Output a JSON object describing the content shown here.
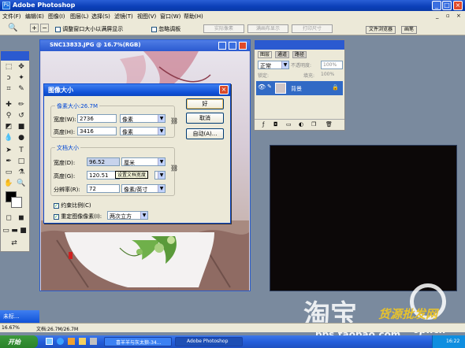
{
  "app": {
    "title": "Adobe Photoshop"
  },
  "window_controls": {
    "minimize": "_",
    "maximize": "□",
    "close": "×"
  },
  "menu": [
    "文件(F)",
    "编辑(E)",
    "图像(I)",
    "图层(L)",
    "选择(S)",
    "滤镜(T)",
    "视图(V)",
    "窗口(W)",
    "帮助(H)"
  ],
  "options_bar": {
    "fit_window_label": "调整窗口大小以满屏显示",
    "ignore_palettes_label": "忽略调板",
    "actual_pixels": "实际像素",
    "fit_screen": "满画布显示",
    "print_size": "打印尺寸"
  },
  "top_tabs": [
    "文件浏览器",
    "画笔"
  ],
  "document": {
    "title": "SNC13833.JPG @ 16.7%(RGB)"
  },
  "dialog": {
    "title": "图像大小",
    "pixel_dims": {
      "legend": "像素大小:26.7M",
      "width_label": "宽度(W):",
      "width_value": "2736",
      "width_unit": "像素",
      "height_label": "高度(H):",
      "height_value": "3416",
      "height_unit": "像素"
    },
    "doc_size": {
      "legend": "文档大小",
      "width_label": "宽度(D):",
      "width_value": "96.52",
      "width_unit": "厘米",
      "height_label": "高度(G):",
      "height_value": "120.51",
      "tooltip": "设置文档宽度",
      "res_label": "分辨率(R):",
      "res_value": "72",
      "res_unit": "像素/英寸"
    },
    "constrain_label": "约束比例(C)",
    "resample_label": "重定图像像素(I):",
    "resample_value": "两次立方",
    "ok": "好",
    "cancel": "取消",
    "auto": "自动(A)..."
  },
  "layers_panel": {
    "tabs": [
      "图层",
      "通道",
      "路径"
    ],
    "blend_mode": "正常",
    "opacity_label": "不透明度:",
    "opacity_value": "100%",
    "lock_label": "锁定:",
    "fill_label": "填充:",
    "fill_value": "100%",
    "layer_name": "背景"
  },
  "minimized_doc": {
    "label": "未标..."
  },
  "status": {
    "zoom": "16.67%",
    "doc_info": "文档:26.7M/26.7M"
  },
  "taskbar": {
    "start": "开始",
    "tasks": [
      "喜羊羊与灰太狼-34...",
      "Adobe Photoshop"
    ],
    "clock": "16:22"
  },
  "watermarks": {
    "taobao": "淘宝",
    "site_cn": "货源批发网",
    "bbs": "bbs.taobao.com",
    "pf": "6pf.cn"
  }
}
